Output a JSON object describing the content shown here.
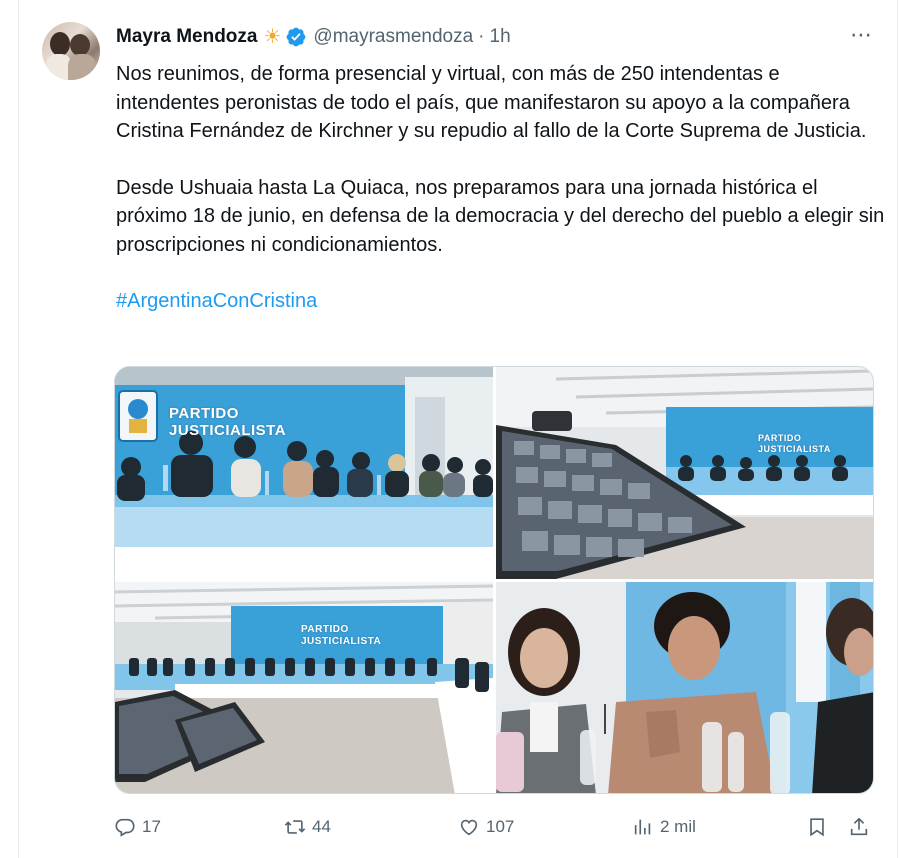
{
  "author": {
    "name": "Mayra Mendoza",
    "emoji": "☀",
    "handle": "@mayrasmendoza",
    "separator": "·",
    "time": "1h"
  },
  "more_icon": "⋯",
  "tweet": {
    "paragraph1": "Nos reunimos, de forma presencial y virtual, con más de 250 intendentas e intendentes peronistas de todo el país, que manifestaron su apoyo a la compañera Cristina Fernández de Kirchner y su repudio al fallo de la Corte Suprema de Justicia.",
    "paragraph2": "Desde Ushuaia hasta La Quiaca, nos preparamos para una jornada histórica el próximo 18 de junio, en defensa de la democracia y del derecho del pueblo a elegir sin proscripciones ni condicionamientos.",
    "hashtag": "#ArgentinaConCristina"
  },
  "media": {
    "photo1_label": "PARTIDO JUSTICIALISTA",
    "photo2_label": "PARTIDO JUSTICIALISTA",
    "photo3_label": "PARTIDO JUSTICIALISTA"
  },
  "actions": {
    "replies": "17",
    "reposts": "44",
    "likes": "107",
    "views": "2 mil"
  },
  "icons": {
    "reply": "reply-icon",
    "repost": "repost-icon",
    "like": "heart-icon",
    "views": "views-icon",
    "bookmark": "bookmark-icon",
    "share": "share-icon",
    "verified": "verified-icon",
    "more": "more-icon"
  },
  "colors": {
    "accent": "#1d9bf0",
    "text": "#0f1419",
    "muted": "#536471",
    "sun": "#f5a623"
  }
}
